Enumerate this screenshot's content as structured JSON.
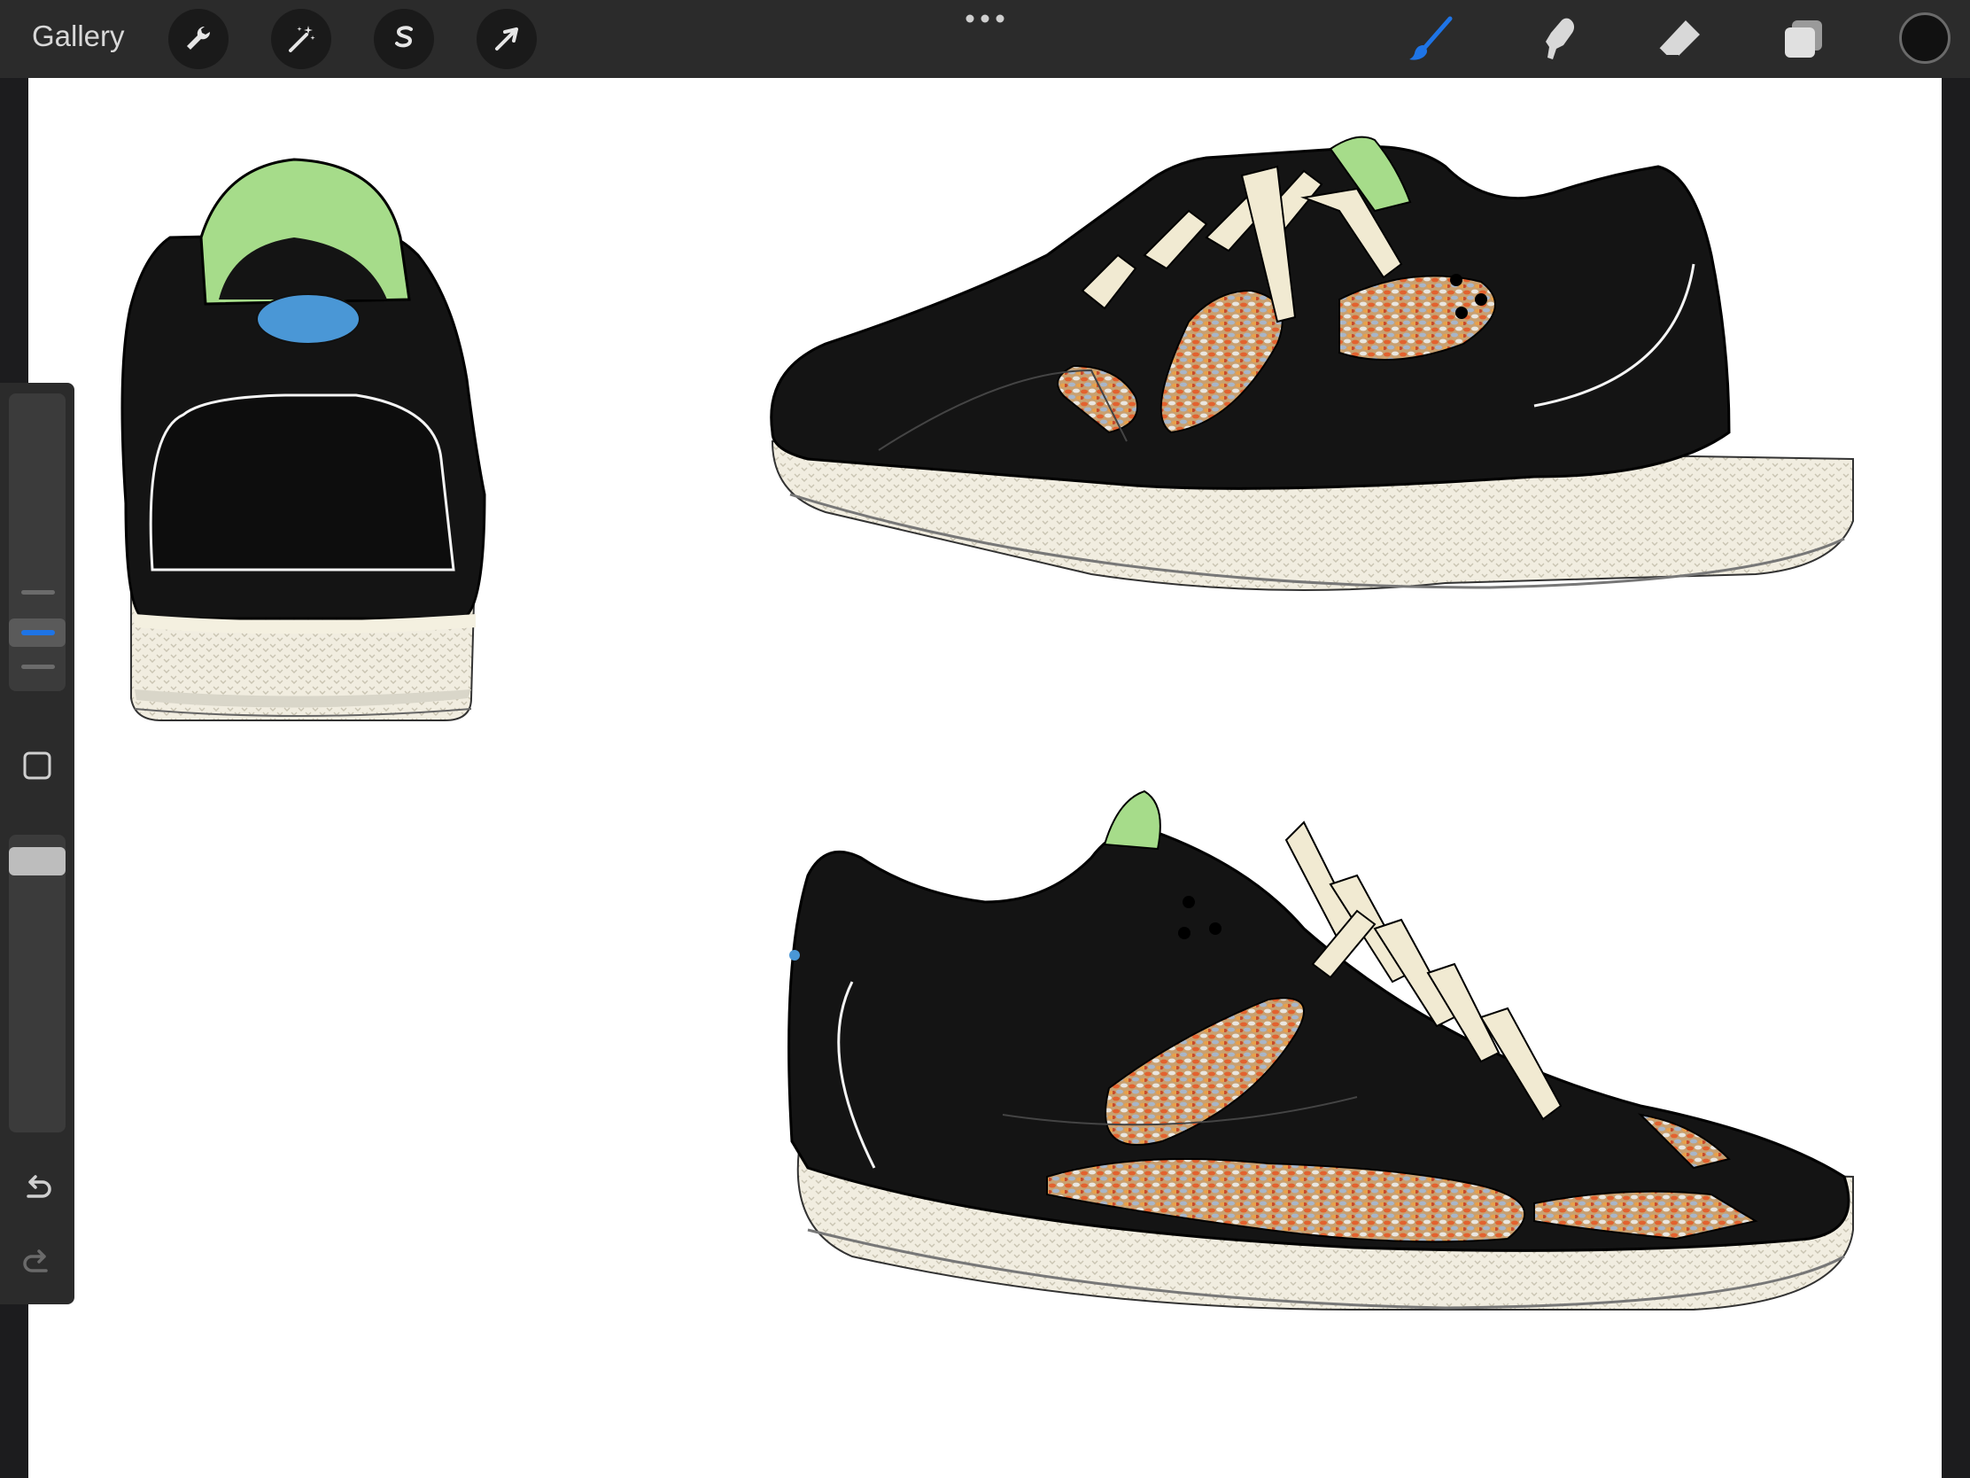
{
  "topbar": {
    "gallery_label": "Gallery",
    "left_tools": [
      "wrench-icon",
      "magic-wand-icon",
      "selection-icon",
      "transform-arrow-icon"
    ],
    "more_icon": "more-dots-icon",
    "right_tools": [
      "brush-icon",
      "smudge-icon",
      "eraser-icon",
      "layers-icon"
    ],
    "active_tool": "brush-icon",
    "current_color": "#111111"
  },
  "sidebar": {
    "brush_size_level": 0.4,
    "opacity_level": 0.95,
    "modify_button": "square-icon",
    "undo_icon": "undo-icon",
    "redo_icon": "redo-icon"
  },
  "canvas": {
    "content": [
      "sneaker-back-view",
      "sneaker-side-view-upper",
      "sneaker-side-view-lower"
    ]
  },
  "colors": {
    "accent": "#1e74e6",
    "shoe_black": "#141414",
    "sole_cream": "#f4f0e0",
    "collar_green": "#a6dc8a",
    "heel_blue": "#4a97d6",
    "lace_cream": "#f1ead2"
  }
}
